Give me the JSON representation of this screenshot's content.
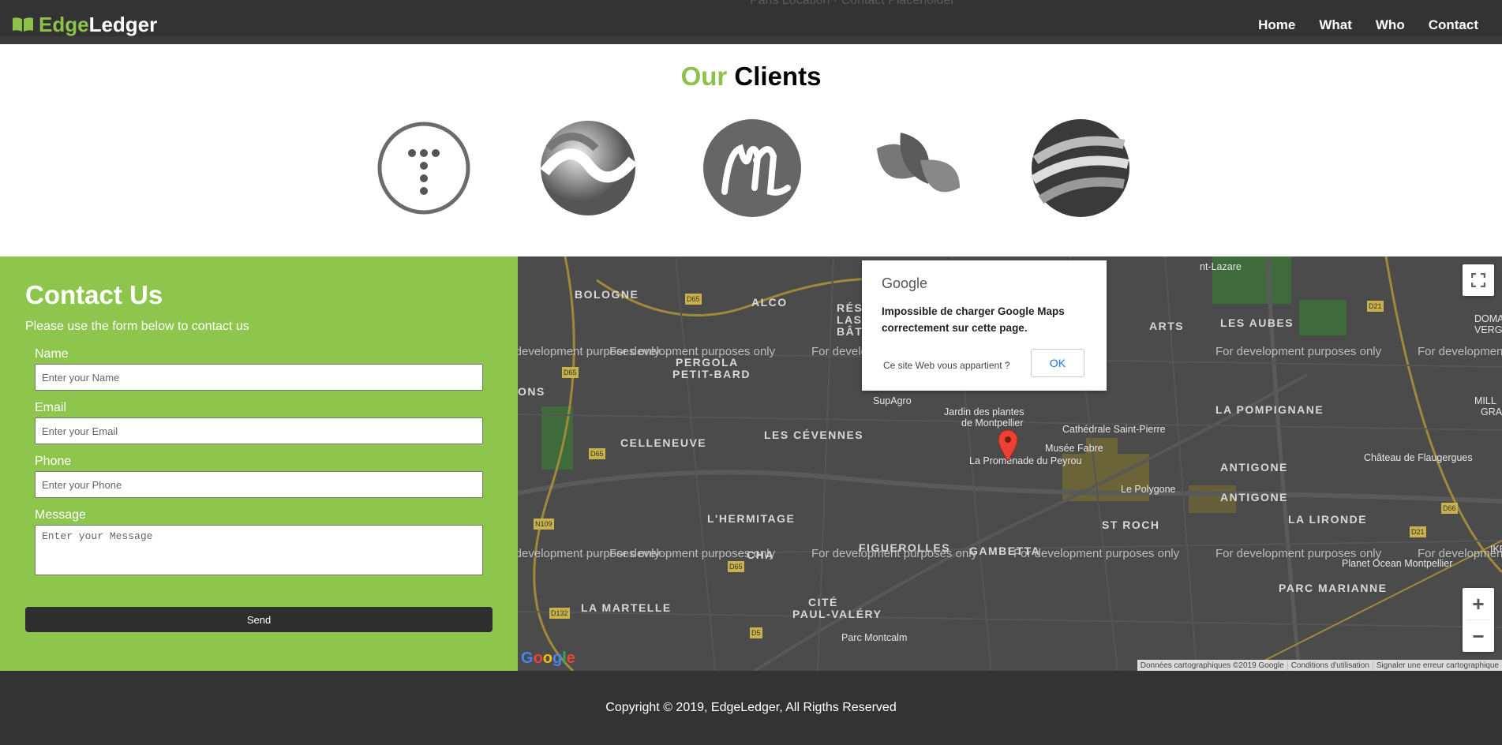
{
  "nav": {
    "brand_part1": "Edge",
    "brand_part2": "Ledger",
    "bg_text": "Paris Location · Contact Placeholder",
    "links": [
      "Home",
      "What",
      "Who",
      "Contact"
    ]
  },
  "clients": {
    "title_part1": "Our",
    "title_part2": "Clients",
    "logos": [
      "t-dots-logo",
      "wave-sphere-logo",
      "m-script-logo",
      "leaves-logo",
      "ribbon-sphere-logo"
    ]
  },
  "contact": {
    "title": "Contact Us",
    "subtitle": "Please use the form below to contact us",
    "fields": [
      {
        "label": "Name",
        "placeholder": "Enter your Name"
      },
      {
        "label": "Email",
        "placeholder": "Enter your Email"
      },
      {
        "label": "Phone",
        "placeholder": "Enter your Phone"
      },
      {
        "label": "Message",
        "placeholder": "Enter your Message"
      }
    ],
    "send_label": "Send"
  },
  "map": {
    "watermark": "For development purposes only",
    "places": [
      "BOLOGNE",
      "ALCO",
      "RÉSIDE",
      "LAS RÉ",
      "BÂTIM",
      "PERGOLA",
      "PETIT-BARD",
      "CELLENEUVE",
      "LES CÉVENNES",
      "L'HERMITAGE",
      "FIGUEROLLES",
      "GAMBETTA",
      "ST ROCH",
      "ANTIGONE",
      "ANTIGONE",
      "LA POMPIGNANE",
      "LA LIRONDE",
      "PARC MARIANNE",
      "LA MARTELLE",
      "CITÉ",
      "PAUL-VALÉRY",
      "LES AUBES",
      "ARTS",
      "ONS",
      "CHA"
    ],
    "pois": [
      "Jardin des plantes",
      "de Montpellier",
      "Cathédrale Saint-Pierre",
      "Musée Fabre",
      "La Promenade du Peyrou",
      "Le Polygone",
      "SupAgro",
      "Château de Flaugergues",
      "Parc Montcalm",
      "Planet Ocean Montpellier",
      "DOMA",
      "VERG",
      "MILL",
      "GRA",
      "nt-Lazare",
      "IKE"
    ],
    "roads": [
      "D65",
      "D65",
      "D65",
      "N109",
      "D132",
      "D5",
      "D21",
      "D21",
      "D66",
      "D65"
    ],
    "dialog": {
      "brand": "Google",
      "message": "Impossible de charger Google Maps correctement sur cette page.",
      "question": "Ce site Web vous appartient ?",
      "ok": "OK"
    },
    "attribution": [
      "Données cartographiques ©2019 Google",
      "Conditions d'utilisation",
      "Signaler une erreur cartographique"
    ],
    "zoom_in": "+",
    "zoom_out": "−",
    "google_logo": "Google"
  },
  "footer": {
    "copyright": "Copyright © 2019, EdgeLedger, All Rigths Reserved"
  },
  "colors": {
    "accent": "#8ec64d",
    "dark": "#333333",
    "map_bg": "#4a4a4a"
  }
}
